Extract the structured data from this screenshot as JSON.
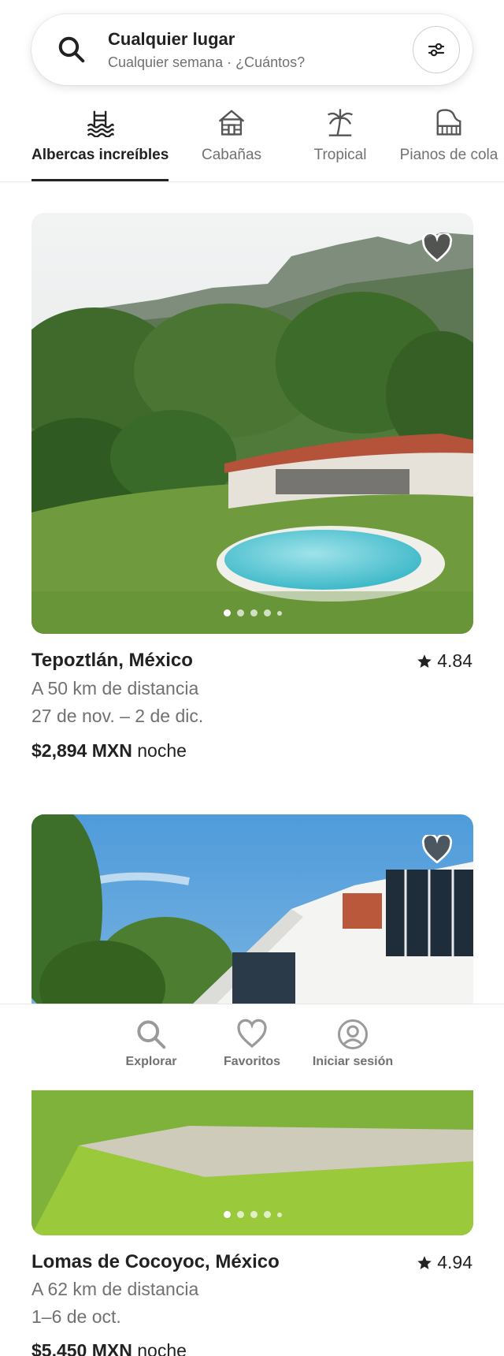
{
  "search": {
    "title": "Cualquier lugar",
    "subtitle": "Cualquier semana · ¿Cuántos?"
  },
  "categories": [
    {
      "label": "Albercas increíbles",
      "icon": "pool-icon",
      "active": true
    },
    {
      "label": "Cabañas",
      "icon": "cabin-icon",
      "active": false
    },
    {
      "label": "Tropical",
      "icon": "palm-tree-icon",
      "active": false
    },
    {
      "label": "Pianos de cola",
      "icon": "piano-icon",
      "active": false
    }
  ],
  "listings": [
    {
      "location": "Tepoztlán, México",
      "rating": "4.84",
      "distance": "A 50 km de distancia",
      "dates": "27 de nov. – 2 de dic.",
      "price": "$2,894 MXN",
      "price_unit": "noche",
      "photo_count": 5,
      "active_photo": 0
    },
    {
      "location": "Lomas de Cocoyoc, México",
      "rating": "4.94",
      "distance": "A 62 km de distancia",
      "dates": "1–6 de oct.",
      "price": "$5,450 MXN",
      "price_unit": "noche",
      "photo_count": 5,
      "active_photo": 0
    }
  ],
  "bottom_nav": [
    {
      "label": "Explorar",
      "icon": "search-icon"
    },
    {
      "label": "Favoritos",
      "icon": "heart-icon"
    },
    {
      "label": "Iniciar sesión",
      "icon": "profile-icon"
    }
  ],
  "colors": {
    "text": "#222222",
    "muted": "#717171",
    "heart_fill": "#4a4a4a"
  }
}
